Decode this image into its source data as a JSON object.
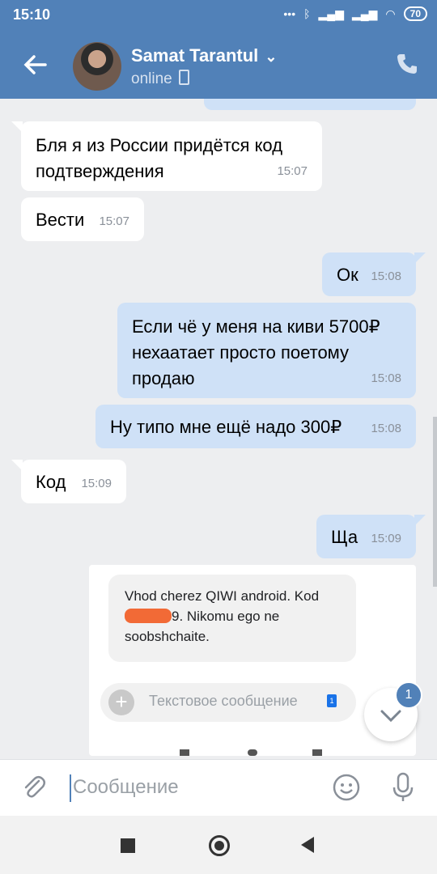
{
  "status_bar": {
    "time": "15:10",
    "battery": "70"
  },
  "header": {
    "name": "Samat Tarantul",
    "status": "online"
  },
  "messages": [
    {
      "text": "Бля я из России придётся код подтверждения",
      "time": "15:07"
    },
    {
      "text": "Вести",
      "time": "15:07"
    },
    {
      "text": "Ок",
      "time": "15:08"
    },
    {
      "text": "Если чё у меня на киви 5700₽ нехаатает просто поетому продаю",
      "time": "15:08"
    },
    {
      "text": "Ну типо мне ещё надо 300₽",
      "time": "15:08"
    },
    {
      "text": "Код",
      "time": "15:09"
    },
    {
      "text": "Ща",
      "time": "15:09"
    }
  ],
  "screenshot": {
    "sms_part1": "Vhod cherez QIWI android. Kod",
    "sms_part2": "9. Nikomu ego ne soobshchaite.",
    "input_placeholder": "Текстовое сообщение"
  },
  "scroll_badge": "1",
  "composer": {
    "placeholder": "Сообщение"
  },
  "colors": {
    "header": "#5181b8",
    "outgoing": "#cfe1f7",
    "incoming": "#ffffff",
    "background": "#edeef0"
  }
}
